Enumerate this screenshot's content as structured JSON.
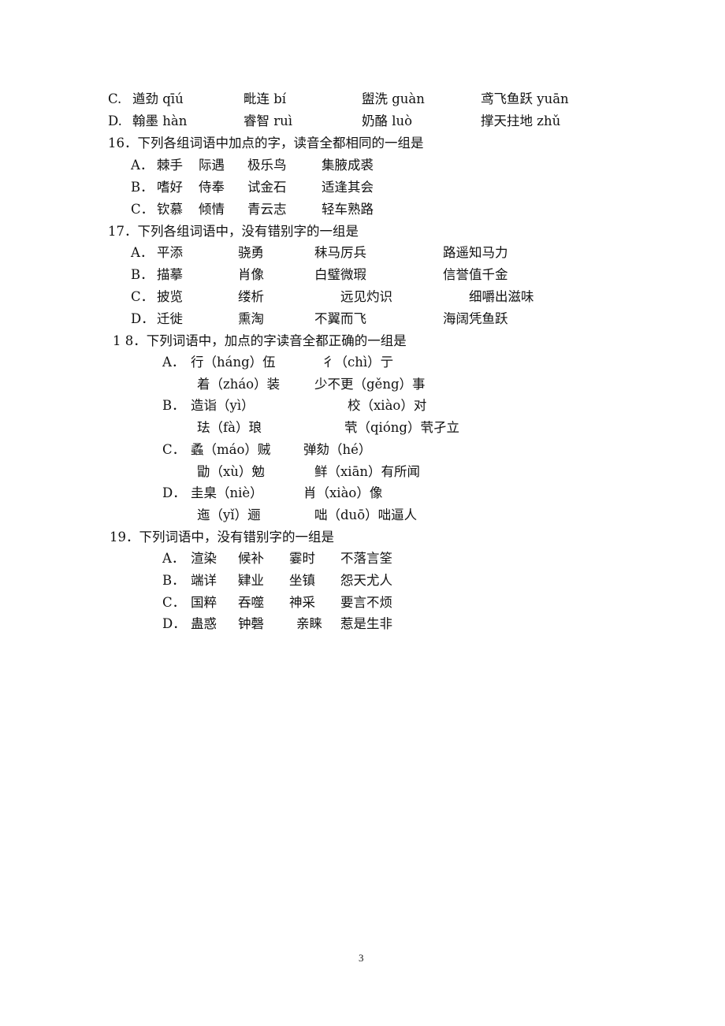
{
  "page_number": "3",
  "q15_tail": {
    "options": [
      {
        "label": "C.",
        "items": [
          "遒劲 qīú",
          "毗连 bí",
          "盥洗 guàn",
          "鸢飞鱼跃 yuān"
        ]
      },
      {
        "label": "D.",
        "items": [
          "翰墨 hàn",
          "睿智 ruì",
          "奶酪 luò",
          "撑天拄地 zhǔ"
        ]
      }
    ]
  },
  "q16": {
    "stem": "16．下列各组词语中加点的字，读音全都相同的一组是",
    "options": [
      {
        "label": "A．",
        "items": [
          "棘手",
          "际遇",
          "极乐鸟",
          "集腋成裘"
        ]
      },
      {
        "label": "B．",
        "items": [
          "嗜好",
          "侍奉",
          "试金石",
          "适逢其会"
        ]
      },
      {
        "label": "C．",
        "items": [
          "钦慕",
          "倾情",
          "青云志",
          "轻车熟路"
        ]
      }
    ]
  },
  "q17": {
    "stem": "17．下列各组词语中，没有错别字的一组是",
    "options": [
      {
        "label": "A．",
        "items": [
          "平添",
          "骁勇",
          "秣马厉兵",
          "路遥知马力"
        ]
      },
      {
        "label": "B．",
        "items": [
          "描摹",
          "肖像",
          "白璧微瑕",
          "信誉值千金"
        ]
      },
      {
        "label": "C．",
        "items": [
          "披览",
          "缕析",
          "远见灼识",
          "细嚼出滋味"
        ]
      },
      {
        "label": "D．",
        "items": [
          "迁徙",
          "熏淘",
          "不翼而飞",
          "海阔凭鱼跃"
        ]
      }
    ]
  },
  "q18": {
    "stem": "1 8．下列词语中，加点的字读音全都正确的一组是",
    "options": [
      {
        "label": "A．",
        "row1": [
          "行（háng）伍",
          "彳（chì）亍"
        ],
        "row2": [
          "着（zháo）装",
          "少不更（gěng）事"
        ]
      },
      {
        "label": "B．",
        "row1": [
          "造诣（yì）",
          "校（xiào）对"
        ],
        "row2": [
          "珐（fà）琅",
          "茕（qióng）茕孑立"
        ]
      },
      {
        "label": "C．",
        "row1": [
          "蟊（máo）贼",
          "弹劾（hé）"
        ],
        "row2": [
          "勖（xù）勉",
          "鲜（xiān）有所闻"
        ]
      },
      {
        "label": "D．",
        "row1": [
          "圭臬（niè）",
          "肖（xiào）像"
        ],
        "row2": [
          "迤（yǐ）逦",
          "咄（duō）咄逼人"
        ]
      }
    ]
  },
  "q19": {
    "stem": "19．下列词语中，没有错别字的一组是",
    "options": [
      {
        "label": "A．",
        "items": [
          "渲染",
          "候补",
          "霎时",
          "不落言筌"
        ]
      },
      {
        "label": "B．",
        "items": [
          "端详",
          "肄业",
          "坐镇",
          "怨天尤人"
        ]
      },
      {
        "label": "C．",
        "items": [
          "国粹",
          "吞噬",
          "神采",
          "要言不烦"
        ]
      },
      {
        "label": "D．",
        "items": [
          "蛊惑",
          "钟磬",
          "亲睐",
          "惹是生非"
        ]
      }
    ]
  }
}
